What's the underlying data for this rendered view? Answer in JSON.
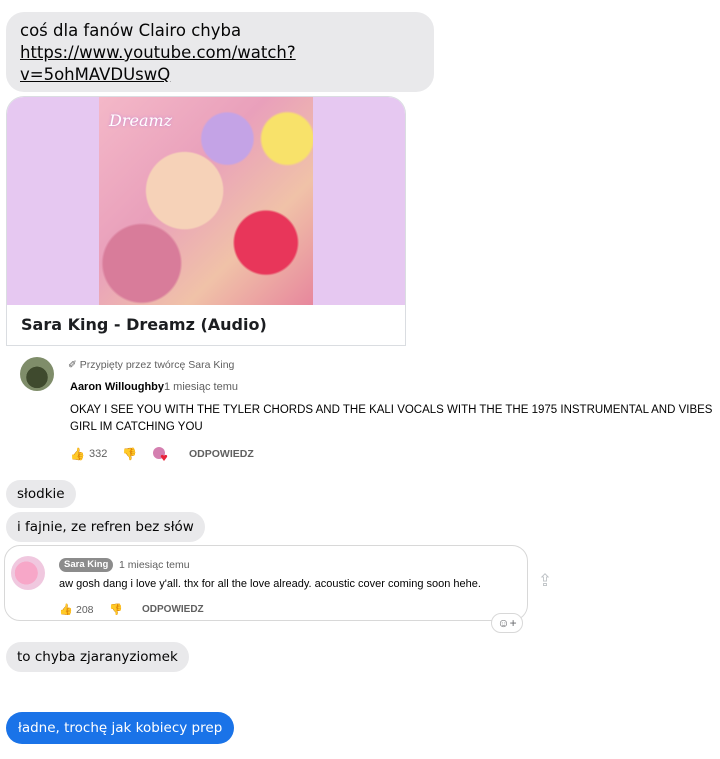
{
  "messages": {
    "m1_text": "coś dla fanów Clairo chyba",
    "m1_link": "https://www.youtube.com/watch?v=5ohMAVDUswQ",
    "m2": "słodkie",
    "m3": "i fajnie, ze refren bez słów",
    "m4": "to chyba zjaranyziomek",
    "m5_sent": "ładne, trochę jak kobiecy prep"
  },
  "link_card": {
    "thumbnail_label": "Dreamz",
    "title": "Sara King - Dreamz (Audio)"
  },
  "comment1": {
    "pinned": "Przypięty przez twórcę Sara King",
    "author": "Aaron Willoughby",
    "time": "1 miesiąc temu",
    "text": "OKAY I SEE YOU WITH THE TYLER CHORDS AND THE KALI VOCALS WITH THE THE 1975 INSTRUMENTAL AND VIBES GIRL IM CATCHING YOU",
    "likes": "332",
    "reply": "ODPOWIEDZ"
  },
  "comment2": {
    "author": "Sara King",
    "time": "1 miesiąc temu",
    "text": "aw gosh dang i love y'all. thx for all the love already. acoustic cover coming soon hehe.",
    "likes": "208",
    "reply": "ODPOWIEDZ"
  },
  "icons": {
    "pin": "pin-icon",
    "like": "thumbs-up-icon",
    "dislike": "thumbs-down-icon",
    "share": "share-icon",
    "react": "emoji-react-icon"
  },
  "colors": {
    "incoming_bubble": "#e9e9eb",
    "outgoing_bubble": "#1a73e8",
    "thumb_bg": "#e6c8f1"
  }
}
